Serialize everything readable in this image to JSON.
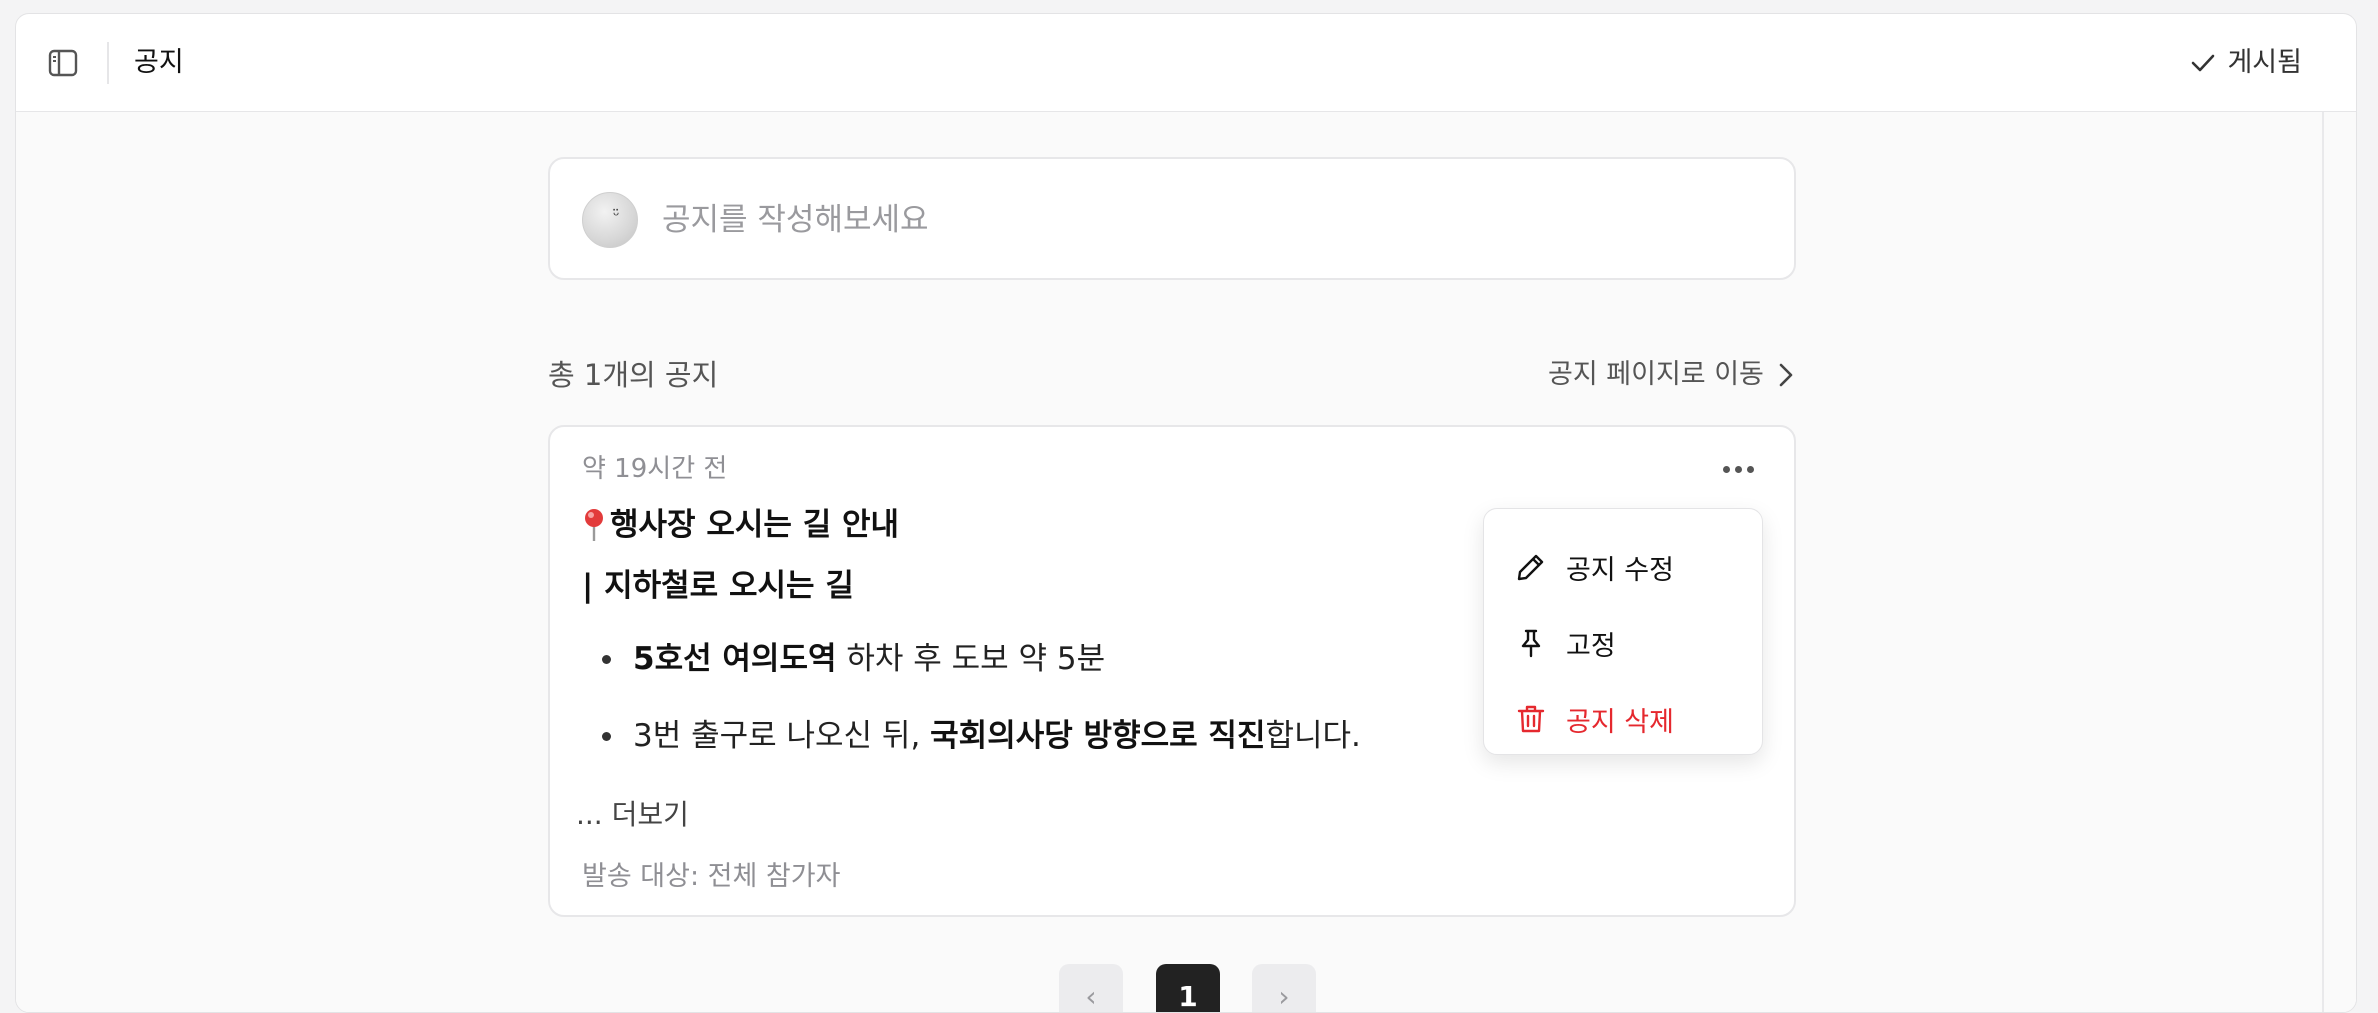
{
  "header": {
    "title": "공지",
    "status_label": "게시됨"
  },
  "composer": {
    "placeholder": "공지를 작성해보세요"
  },
  "list": {
    "count_label": "총 1개의 공지",
    "goto_label": "공지 페이지로 이동"
  },
  "notice": {
    "time": "약 19시간 전",
    "title": "행사장 오시는 길 안내",
    "subtitle": "| 지하철로 오시는 길",
    "bullets": [
      {
        "bold": "5호선 여의도역",
        "rest": " 하차 후 도보 약 5분"
      },
      {
        "pre": "3번 출구로 나오신 뒤, ",
        "bold": "국회의사당 방향으로 직진",
        "post": "합니다."
      }
    ],
    "more_label": "... 더보기",
    "target_label": "발송 대상: 전체 참가자"
  },
  "menu": {
    "items": [
      {
        "label": "공지 수정",
        "icon": "pencil-icon"
      },
      {
        "label": "고정",
        "icon": "pin-icon"
      },
      {
        "label": "공지 삭제",
        "icon": "trash-icon",
        "color": "#e5282e"
      }
    ]
  },
  "pagination": {
    "prev": "‹",
    "current": "1",
    "next": "›"
  }
}
